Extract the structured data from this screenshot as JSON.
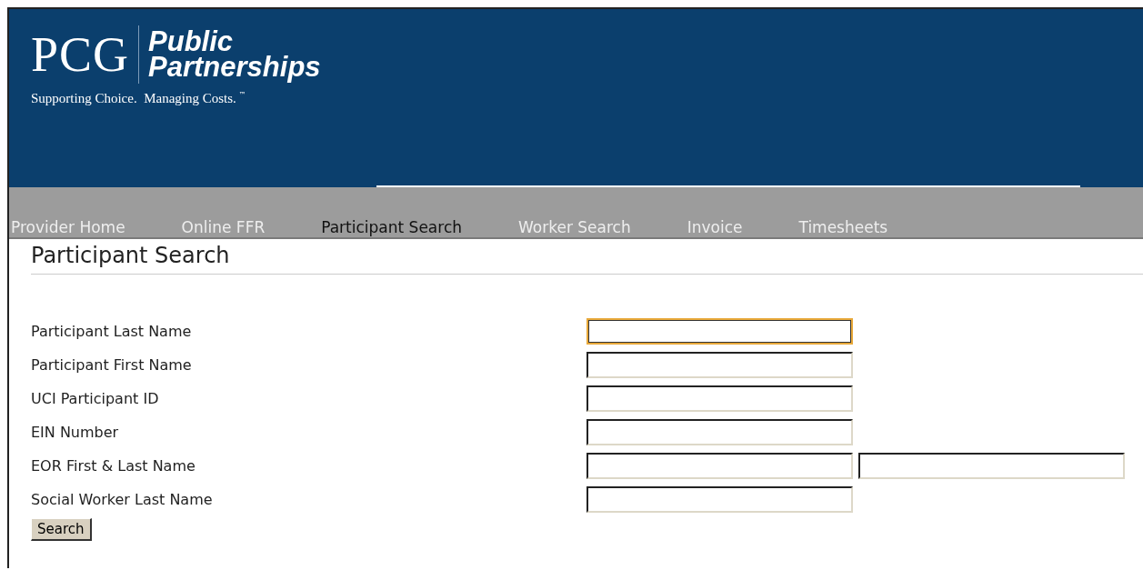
{
  "logo": {
    "mark": "PCG",
    "name_line_1": "Public",
    "name_line_2": "Partnerships",
    "tagline": "Supporting Choice.  Managing Costs.",
    "trademark": "™"
  },
  "nav": [
    {
      "label": "Provider Home",
      "selected": false
    },
    {
      "label": "Online FFR",
      "selected": false
    },
    {
      "label": "Participant Search",
      "selected": true
    },
    {
      "label": "Worker Search",
      "selected": false
    },
    {
      "label": "Invoice",
      "selected": false
    },
    {
      "label": "Timesheets",
      "selected": false
    }
  ],
  "page_title": "Participant Search",
  "form": [
    {
      "label": "Participant Last Name",
      "fields": [
        {
          "focused": true
        }
      ]
    },
    {
      "label": "Participant First Name",
      "fields": [
        {
          "focused": false
        }
      ]
    },
    {
      "label": "UCI Participant ID",
      "fields": [
        {
          "focused": false
        }
      ]
    },
    {
      "label": "EIN Number",
      "fields": [
        {
          "focused": false
        }
      ]
    },
    {
      "label": "EOR First & Last Name",
      "fields": [
        {
          "focused": false
        },
        {
          "focused": false
        }
      ]
    },
    {
      "label": "Social Worker Last Name",
      "fields": [
        {
          "focused": false
        }
      ]
    }
  ],
  "search_button": "Search"
}
